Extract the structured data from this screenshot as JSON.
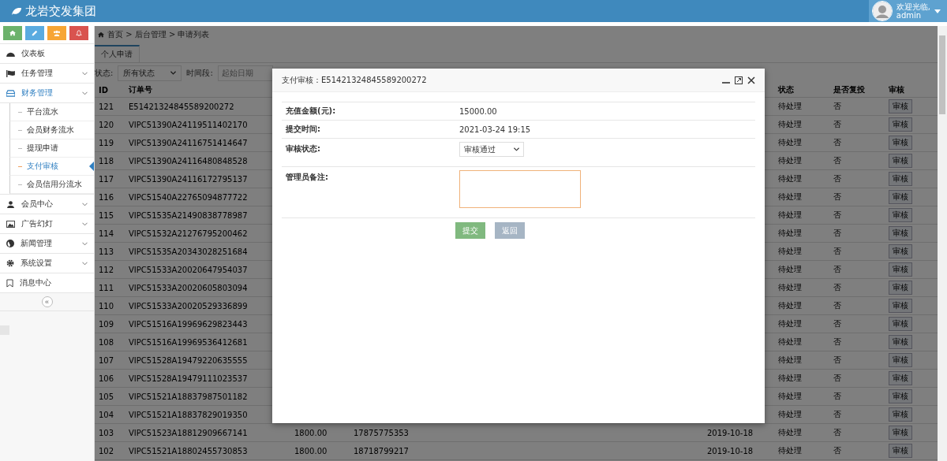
{
  "header": {
    "brand": "龙岩交发集团",
    "user": {
      "greeting": "欢迎光临,",
      "name": "admin"
    }
  },
  "sidebar": {
    "quick_buttons": [
      {
        "kind": "home",
        "color": "#6cb26c"
      },
      {
        "kind": "pencil",
        "color": "#5aabe0"
      },
      {
        "kind": "users",
        "color": "#f7a535"
      },
      {
        "kind": "bell",
        "color": "#d9534f"
      }
    ],
    "menu": [
      {
        "label": "仪表板",
        "kind": "link",
        "selected": false
      },
      {
        "label": "任务管理",
        "kind": "group",
        "selected": false
      },
      {
        "label": "财务管理",
        "kind": "group",
        "selected": true,
        "children": [
          {
            "label": "平台流水",
            "selected": false
          },
          {
            "label": "会员财务流水",
            "selected": false
          },
          {
            "label": "提现申请",
            "selected": false
          },
          {
            "label": "支付审核",
            "selected": true
          },
          {
            "label": "会员信用分流水",
            "selected": false
          }
        ]
      },
      {
        "label": "会员中心",
        "kind": "group",
        "selected": false
      },
      {
        "label": "广告幻灯",
        "kind": "group",
        "selected": false
      },
      {
        "label": "新闻管理",
        "kind": "group",
        "selected": false
      },
      {
        "label": "系统设置",
        "kind": "group",
        "selected": false
      },
      {
        "label": "消息中心",
        "kind": "link",
        "selected": false
      }
    ],
    "collapse": "«"
  },
  "main": {
    "breadcrumb": "首页 > 后台管理 > 申请列表",
    "tabs": [
      {
        "label": "个人申请",
        "selected": true
      }
    ],
    "filters": {
      "status_label": "状态:",
      "status_value": "所有状态",
      "period_label": "时间段:",
      "start_placeholder": "起始日期"
    },
    "table": {
      "header": {
        "id": "ID",
        "order": "订单号",
        "status": "状态",
        "repeat": "是否复投",
        "audit": "审核"
      },
      "rows": [
        {
          "id": "121",
          "order": "E51421324845589200272",
          "status": "待处理",
          "repeat": "否",
          "audit": "审核"
        },
        {
          "id": "120",
          "order": "VIPC51390A24119511402170",
          "status": "待处理",
          "repeat": "否",
          "audit": "审核"
        },
        {
          "id": "119",
          "order": "VIPC51390A24116751414647",
          "status": "待处理",
          "repeat": "否",
          "audit": "审核"
        },
        {
          "id": "118",
          "order": "VIPC51390A24116480848528",
          "status": "待处理",
          "repeat": "否",
          "audit": "审核"
        },
        {
          "id": "117",
          "order": "VIPC51390A24116172795137",
          "status": "待处理",
          "repeat": "否",
          "audit": "审核"
        },
        {
          "id": "116",
          "order": "VIPC51540A22765094877722",
          "status": "待处理",
          "repeat": "否",
          "audit": "审核"
        },
        {
          "id": "115",
          "order": "VIPC51535A21490838778987",
          "status": "待处理",
          "repeat": "否",
          "audit": "审核"
        },
        {
          "id": "114",
          "order": "VIPC51532A21276795200462",
          "status": "待处理",
          "repeat": "否",
          "audit": "审核"
        },
        {
          "id": "113",
          "order": "VIPC51535A20343028251684",
          "status": "待处理",
          "repeat": "否",
          "audit": "审核"
        },
        {
          "id": "112",
          "order": "VIPC51533A20020647954037",
          "status": "待处理",
          "repeat": "否",
          "audit": "审核"
        },
        {
          "id": "111",
          "order": "VIPC51533A20020605803094",
          "status": "待处理",
          "repeat": "否",
          "audit": "审核"
        },
        {
          "id": "110",
          "order": "VIPC51533A20020529336899",
          "status": "待处理",
          "repeat": "否",
          "audit": "审核"
        },
        {
          "id": "109",
          "order": "VIPC51516A19969629823443",
          "status": "待处理",
          "repeat": "否",
          "audit": "审核"
        },
        {
          "id": "108",
          "order": "VIPC51516A19969536412681",
          "status": "待处理",
          "repeat": "否",
          "audit": "审核"
        },
        {
          "id": "107",
          "order": "VIPC51528A19479220635555",
          "status": "待处理",
          "repeat": "否",
          "audit": "审核"
        },
        {
          "id": "106",
          "order": "VIPC51528A19479111023537",
          "status": "待处理",
          "repeat": "否",
          "audit": "审核"
        },
        {
          "id": "105",
          "order": "VIPC51521A18837987501182",
          "status": "待处理",
          "repeat": "否",
          "audit": "审核"
        },
        {
          "id": "104",
          "order": "VIPC51521A18837829019350",
          "status": "待处理",
          "repeat": "否",
          "audit": "审核"
        },
        {
          "id": "103",
          "order": "VIPC51523A18812909667141",
          "amount": "1800.00",
          "phone": "17875775353",
          "date": "2019-10-18",
          "status": "待处理",
          "repeat": "否",
          "audit": "审核"
        },
        {
          "id": "102",
          "order": "VIPC51521A18802455730853",
          "amount": "1800.00",
          "phone": "18718799217",
          "date": "2019-10-18",
          "status": "待处理",
          "repeat": "否",
          "audit": "审核"
        }
      ]
    }
  },
  "modal": {
    "title": "支付审核：E51421324845589200272",
    "fields": [
      {
        "label": "充值金额(元):",
        "kind": "text",
        "value": "15000.00"
      },
      {
        "label": "提交时间:",
        "kind": "text",
        "value": "2021-03-24 19:15"
      },
      {
        "label": "审核状态:",
        "kind": "select",
        "value": "审核通过"
      },
      {
        "label": "管理员备注:",
        "kind": "textarea",
        "focused": true
      }
    ],
    "buttons": [
      {
        "label": "提交",
        "kind": "primary"
      },
      {
        "label": "返回",
        "kind": "secondary"
      }
    ]
  }
}
